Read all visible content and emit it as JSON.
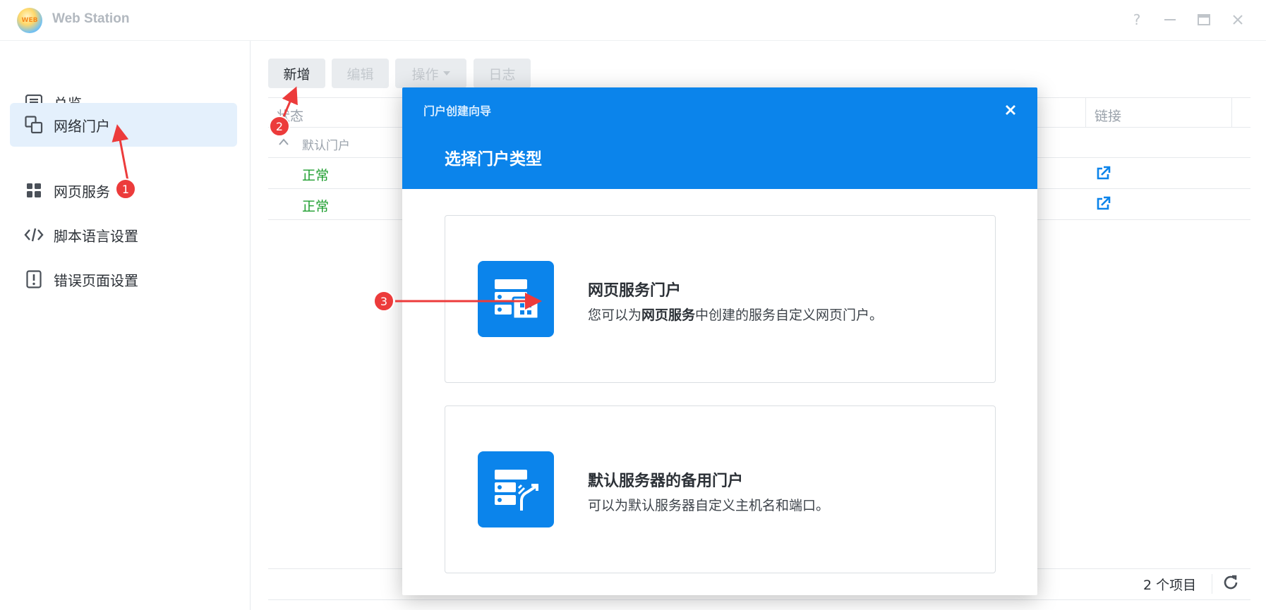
{
  "window": {
    "title": "Web Station",
    "logo_text": "WEB",
    "controls": [
      "help-icon",
      "minimize-icon",
      "maximize-icon",
      "close-icon"
    ],
    "help_glyph": "?"
  },
  "sidebar": {
    "items": [
      {
        "label": "总览",
        "icon": "overview-icon",
        "active": false
      },
      {
        "label": "网络门户",
        "icon": "portal-icon",
        "active": true
      },
      {
        "label": "网页服务",
        "icon": "web-service-icon",
        "active": false
      },
      {
        "label": "脚本语言设置",
        "icon": "code-icon",
        "active": false
      },
      {
        "label": "错误页面设置",
        "icon": "error-page-icon",
        "active": false
      }
    ]
  },
  "toolbar": {
    "add_label": "新增",
    "edit_label": "编辑",
    "action_label": "操作",
    "log_label": "日志"
  },
  "table": {
    "columns": {
      "status": "状态",
      "link": "链接"
    },
    "group_label": "默认门户",
    "rows": [
      {
        "status": "正常"
      },
      {
        "status": "正常"
      }
    ],
    "footer_count": "2 个项目"
  },
  "modal": {
    "title": "门户创建向导",
    "subtitle": "选择门户类型",
    "cards": [
      {
        "title": "网页服务门户",
        "desc_prefix": "您可以为",
        "desc_bold": "网页服务",
        "desc_suffix": "中创建的服务自定义网页门户。",
        "icon": "web-service-portal-icon"
      },
      {
        "title": "默认服务器的备用门户",
        "desc": "可以为默认服务器自定义主机名和端口。",
        "icon": "alternative-portal-icon"
      }
    ]
  },
  "annotations": {
    "badge1": "1",
    "badge2": "2",
    "badge3": "3"
  },
  "colors": {
    "accent": "#0b84eb",
    "status_ok": "#1e9e2f",
    "annotation": "#ec3b3b",
    "active_nav": "#e4f0fc"
  }
}
